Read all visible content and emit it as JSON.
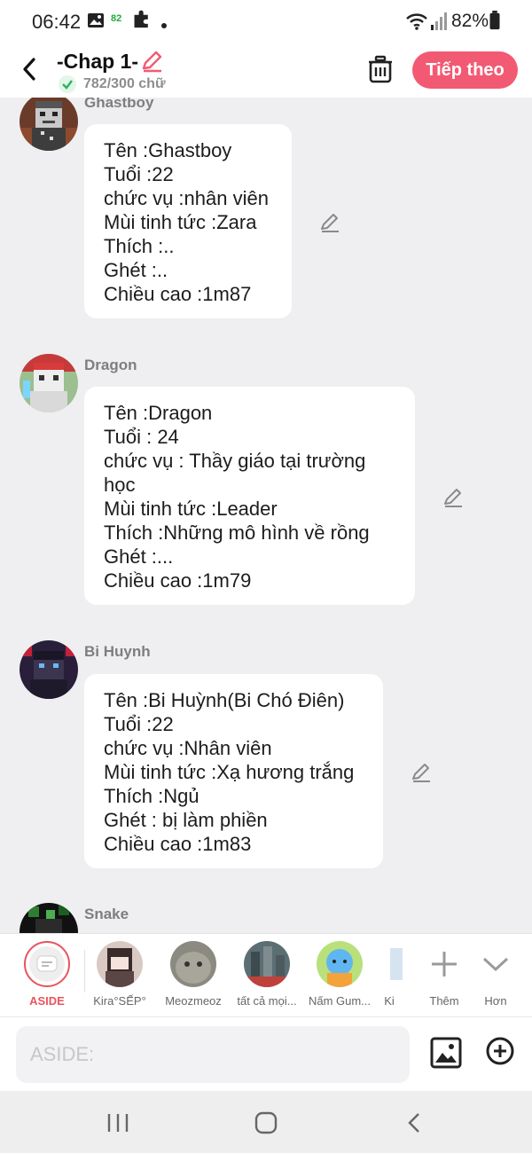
{
  "status_bar": {
    "time": "06:42",
    "notification_badge": "82",
    "battery": "82%",
    "icons": [
      "image-icon",
      "puzzle-icon",
      "dot-icon",
      "wifi-icon",
      "signal-icon",
      "battery-icon"
    ]
  },
  "header": {
    "title": "-Chap 1-",
    "word_count": "782/300 chữ",
    "next_label": "Tiếp theo",
    "accent": "#f25a73"
  },
  "messages": [
    {
      "name": "Ghastboy",
      "lines": [
        "Tên :Ghastboy",
        "Tuổi :22",
        "chức vụ :nhân viên",
        "Mùi tinh tức :Zara",
        "Thích :..",
        "Ghét :..",
        "Chiều cao :1m87"
      ]
    },
    {
      "name": "Dragon",
      "lines": [
        "Tên :Dragon",
        "Tuổi : 24",
        "chức vụ : Thầy giáo tại trường",
        "học",
        "Mùi tinh tức :Leader",
        "Thích :Những mô hình về rồng",
        "Ghét :...",
        "Chiều cao :1m79"
      ]
    },
    {
      "name": "Bi Huynh",
      "lines": [
        "Tên :Bi Huỳnh(Bi Chó Điên)",
        "Tuổi :22",
        "chức vụ :Nhân viên",
        "Mùi tinh tức :Xạ hương trắng",
        "Thích :Ngủ",
        "Ghét : bị làm phiền",
        "Chiều cao :1m83"
      ]
    },
    {
      "name": "Snake",
      "lines": []
    }
  ],
  "characters": {
    "aside_label": "ASIDE",
    "items": [
      "Kira°SẾP°",
      "Meozmeoz",
      "tất cả mọi...",
      "Nấm Gum...",
      "Ki"
    ],
    "more_label": "Thêm",
    "expand_label": "Hơn"
  },
  "composer": {
    "placeholder": "ASIDE:"
  }
}
